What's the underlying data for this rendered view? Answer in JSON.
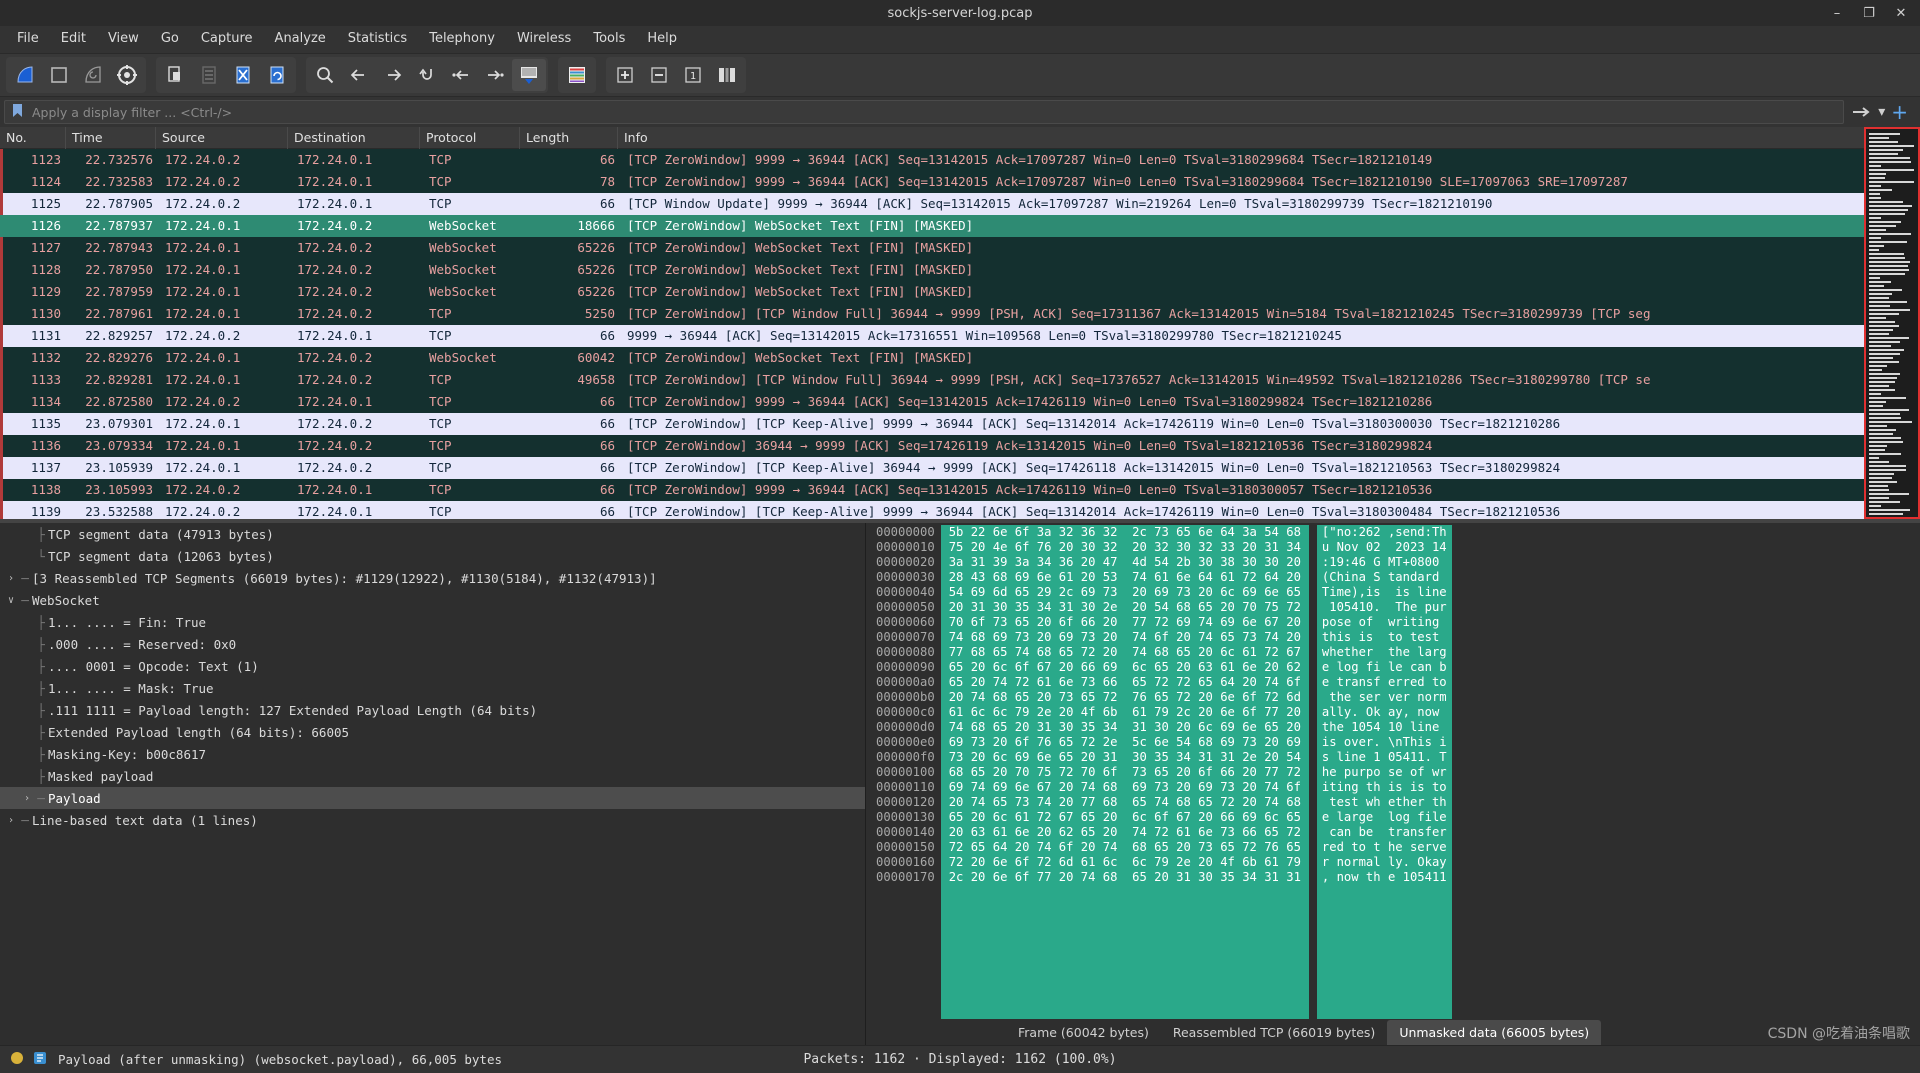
{
  "window": {
    "title": "sockjs-server-log.pcap",
    "controls": {
      "minimize": "–",
      "maximize": "❐",
      "close": "✕"
    }
  },
  "menu": {
    "items": [
      "File",
      "Edit",
      "View",
      "Go",
      "Capture",
      "Analyze",
      "Statistics",
      "Telephony",
      "Wireless",
      "Tools",
      "Help"
    ]
  },
  "toolbar": {
    "groups": [
      [
        "start-capture-icon",
        "stop-capture-icon",
        "restart-capture-icon",
        "capture-options-icon"
      ],
      [
        "open-file-icon",
        "save-file-icon",
        "close-file-icon",
        "reload-file-icon"
      ],
      [
        "find-packet-icon",
        "go-back-icon",
        "go-forward-icon",
        "go-to-packet-icon",
        "go-first-packet-icon",
        "go-last-packet-icon",
        "auto-scroll-icon"
      ],
      [
        "colorize-icon"
      ],
      [
        "zoom-in-icon",
        "zoom-out-icon",
        "zoom-reset-icon",
        "resize-columns-icon"
      ]
    ]
  },
  "filter": {
    "placeholder": "Apply a display filter ... <Ctrl-/>",
    "value": "",
    "bookmark_icon": "bookmark-icon",
    "arrow_icon": "➡",
    "dropdown_icon": "▾",
    "plus_icon": "+"
  },
  "packet_list": {
    "columns": [
      "No.",
      "Time",
      "Source",
      "Destination",
      "Protocol",
      "Length",
      "Info"
    ],
    "rows": [
      {
        "no": "1123",
        "time": "22.732576",
        "src": "172.24.0.2",
        "dst": "172.24.0.1",
        "proto": "TCP",
        "len": "66",
        "info": "[TCP ZeroWindow] 9999 → 36944 [ACK] Seq=13142015 Ack=17097287 Win=0 Len=0 TSval=3180299684 TSecr=1821210149",
        "style": "dark",
        "tick": true
      },
      {
        "no": "1124",
        "time": "22.732583",
        "src": "172.24.0.2",
        "dst": "172.24.0.1",
        "proto": "TCP",
        "len": "78",
        "info": "[TCP ZeroWindow] 9999 → 36944 [ACK] Seq=13142015 Ack=17097287 Win=0 Len=0 TSval=3180299684 TSecr=1821210190 SLE=17097063 SRE=17097287",
        "style": "dark",
        "tick": true
      },
      {
        "no": "1125",
        "time": "22.787905",
        "src": "172.24.0.2",
        "dst": "172.24.0.1",
        "proto": "TCP",
        "len": "66",
        "info": "[TCP Window Update] 9999 → 36944 [ACK] Seq=13142015 Ack=17097287 Win=219264 Len=0 TSval=3180299739 TSecr=1821210190",
        "style": "light",
        "tick": true
      },
      {
        "no": "1126",
        "time": "22.787937",
        "src": "172.24.0.1",
        "dst": "172.24.0.2",
        "proto": "WebSocket",
        "len": "18666",
        "info": "[TCP ZeroWindow] WebSocket Text [FIN] [MASKED]",
        "style": "sel",
        "tick": false
      },
      {
        "no": "1127",
        "time": "22.787943",
        "src": "172.24.0.1",
        "dst": "172.24.0.2",
        "proto": "WebSocket",
        "len": "65226",
        "info": "[TCP ZeroWindow] WebSocket Text [FIN] [MASKED]",
        "style": "dark",
        "tick": true
      },
      {
        "no": "1128",
        "time": "22.787950",
        "src": "172.24.0.1",
        "dst": "172.24.0.2",
        "proto": "WebSocket",
        "len": "65226",
        "info": "[TCP ZeroWindow] WebSocket Text [FIN] [MASKED]",
        "style": "dark",
        "tick": true
      },
      {
        "no": "1129",
        "time": "22.787959",
        "src": "172.24.0.1",
        "dst": "172.24.0.2",
        "proto": "WebSocket",
        "len": "65226",
        "info": "[TCP ZeroWindow] WebSocket Text [FIN] [MASKED]",
        "style": "dark",
        "tick": true
      },
      {
        "no": "1130",
        "time": "22.787961",
        "src": "172.24.0.1",
        "dst": "172.24.0.2",
        "proto": "TCP",
        "len": "5250",
        "info": "[TCP ZeroWindow] [TCP Window Full] 36944 → 9999 [PSH, ACK] Seq=17311367 Ack=13142015 Win=5184 TSval=1821210245 TSecr=3180299739 [TCP seg",
        "style": "dark",
        "tick": true
      },
      {
        "no": "1131",
        "time": "22.829257",
        "src": "172.24.0.2",
        "dst": "172.24.0.1",
        "proto": "TCP",
        "len": "66",
        "info": "9999 → 36944 [ACK] Seq=13142015 Ack=17316551 Win=109568 Len=0 TSval=3180299780 TSecr=1821210245",
        "style": "light",
        "tick": true
      },
      {
        "no": "1132",
        "time": "22.829276",
        "src": "172.24.0.1",
        "dst": "172.24.0.2",
        "proto": "WebSocket",
        "len": "60042",
        "info": "[TCP ZeroWindow] WebSocket Text [FIN] [MASKED]",
        "style": "dark",
        "tick": true
      },
      {
        "no": "1133",
        "time": "22.829281",
        "src": "172.24.0.1",
        "dst": "172.24.0.2",
        "proto": "TCP",
        "len": "49658",
        "info": "[TCP ZeroWindow] [TCP Window Full] 36944 → 9999 [PSH, ACK] Seq=17376527 Ack=13142015 Win=49592 TSval=1821210286 TSecr=3180299780 [TCP se",
        "style": "dark",
        "tick": true
      },
      {
        "no": "1134",
        "time": "22.872580",
        "src": "172.24.0.2",
        "dst": "172.24.0.1",
        "proto": "TCP",
        "len": "66",
        "info": "[TCP ZeroWindow] 9999 → 36944 [ACK] Seq=13142015 Ack=17426119 Win=0 Len=0 TSval=3180299824 TSecr=1821210286",
        "style": "dark",
        "tick": true
      },
      {
        "no": "1135",
        "time": "23.079301",
        "src": "172.24.0.1",
        "dst": "172.24.0.2",
        "proto": "TCP",
        "len": "66",
        "info": "[TCP ZeroWindow] [TCP Keep-Alive] 9999 → 36944 [ACK] Seq=13142014 Ack=17426119 Win=0 Len=0 TSval=3180300030 TSecr=1821210286",
        "style": "light",
        "tick": true
      },
      {
        "no": "1136",
        "time": "23.079334",
        "src": "172.24.0.1",
        "dst": "172.24.0.2",
        "proto": "TCP",
        "len": "66",
        "info": "[TCP ZeroWindow] 36944 → 9999 [ACK] Seq=17426119 Ack=13142015 Win=0 Len=0 TSval=1821210536 TSecr=3180299824",
        "style": "dark",
        "tick": true
      },
      {
        "no": "1137",
        "time": "23.105939",
        "src": "172.24.0.1",
        "dst": "172.24.0.2",
        "proto": "TCP",
        "len": "66",
        "info": "[TCP ZeroWindow] [TCP Keep-Alive] 36944 → 9999 [ACK] Seq=17426118 Ack=13142015 Win=0 Len=0 TSval=1821210563 TSecr=3180299824",
        "style": "light",
        "tick": true
      },
      {
        "no": "1138",
        "time": "23.105993",
        "src": "172.24.0.2",
        "dst": "172.24.0.1",
        "proto": "TCP",
        "len": "66",
        "info": "[TCP ZeroWindow] 9999 → 36944 [ACK] Seq=13142015 Ack=17426119 Win=0 Len=0 TSval=3180300057 TSecr=1821210536",
        "style": "dark",
        "tick": true
      },
      {
        "no": "1139",
        "time": "23.532588",
        "src": "172.24.0.2",
        "dst": "172.24.0.1",
        "proto": "TCP",
        "len": "66",
        "info": "[TCP ZeroWindow] [TCP Keep-Alive] 9999 → 36944 [ACK] Seq=13142014 Ack=17426119 Win=0 Len=0 TSval=3180300484 TSecr=1821210536",
        "style": "light",
        "tick": true
      }
    ]
  },
  "detail_tree": [
    {
      "text": "TCP segment data (47913 bytes)",
      "indent": 2,
      "twist": "",
      "branch": "├",
      "selected": false
    },
    {
      "text": "TCP segment data (12063 bytes)",
      "indent": 2,
      "twist": "",
      "branch": "└",
      "selected": false
    },
    {
      "text": "[3 Reassembled TCP Segments (66019 bytes): #1129(12922), #1130(5184), #1132(47913)]",
      "indent": 1,
      "twist": "›",
      "branch": "",
      "selected": false
    },
    {
      "text": "WebSocket",
      "indent": 1,
      "twist": "∨",
      "branch": "",
      "selected": false
    },
    {
      "text": "1... .... = Fin: True",
      "indent": 2,
      "twist": "",
      "branch": "├",
      "selected": false
    },
    {
      "text": ".000 .... = Reserved: 0x0",
      "indent": 2,
      "twist": "",
      "branch": "├",
      "selected": false
    },
    {
      "text": ".... 0001 = Opcode: Text (1)",
      "indent": 2,
      "twist": "",
      "branch": "├",
      "selected": false
    },
    {
      "text": "1... .... = Mask: True",
      "indent": 2,
      "twist": "",
      "branch": "├",
      "selected": false
    },
    {
      "text": ".111 1111 = Payload length: 127 Extended Payload Length (64 bits)",
      "indent": 2,
      "twist": "",
      "branch": "├",
      "selected": false
    },
    {
      "text": "Extended Payload length (64 bits): 66005",
      "indent": 2,
      "twist": "",
      "branch": "├",
      "selected": false
    },
    {
      "text": "Masking-Key: b00c8617",
      "indent": 2,
      "twist": "",
      "branch": "├",
      "selected": false
    },
    {
      "text": "Masked payload",
      "indent": 2,
      "twist": "",
      "branch": "├",
      "selected": false
    },
    {
      "text": "Payload",
      "indent": 2,
      "twist": "›",
      "branch": "",
      "selected": true
    },
    {
      "text": "Line-based text data (1 lines)",
      "indent": 1,
      "twist": "›",
      "branch": "",
      "selected": false
    }
  ],
  "hex_dump": {
    "rows": [
      {
        "offset": "00000000",
        "hex": "5b 22 6e 6f 3a 32 36 32  2c 73 65 6e 64 3a 54 68",
        "ascii": "[\"no:262 ,send:Th"
      },
      {
        "offset": "00000010",
        "hex": "75 20 4e 6f 76 20 30 32  20 32 30 32 33 20 31 34",
        "ascii": "u Nov 02  2023 14"
      },
      {
        "offset": "00000020",
        "hex": "3a 31 39 3a 34 36 20 47  4d 54 2b 30 38 30 30 20",
        "ascii": ":19:46 G MT+0800"
      },
      {
        "offset": "00000030",
        "hex": "28 43 68 69 6e 61 20 53  74 61 6e 64 61 72 64 20",
        "ascii": "(China S tandard"
      },
      {
        "offset": "00000040",
        "hex": "54 69 6d 65 29 2c 69 73  20 69 73 20 6c 69 6e 65",
        "ascii": "Time),is  is line"
      },
      {
        "offset": "00000050",
        "hex": "20 31 30 35 34 31 30 2e  20 54 68 65 20 70 75 72",
        "ascii": " 105410.  The pur"
      },
      {
        "offset": "00000060",
        "hex": "70 6f 73 65 20 6f 66 20  77 72 69 74 69 6e 67 20",
        "ascii": "pose of  writing"
      },
      {
        "offset": "00000070",
        "hex": "74 68 69 73 20 69 73 20  74 6f 20 74 65 73 74 20",
        "ascii": "this is  to test"
      },
      {
        "offset": "00000080",
        "hex": "77 68 65 74 68 65 72 20  74 68 65 20 6c 61 72 67",
        "ascii": "whether  the larg"
      },
      {
        "offset": "00000090",
        "hex": "65 20 6c 6f 67 20 66 69  6c 65 20 63 61 6e 20 62",
        "ascii": "e log fi le can b"
      },
      {
        "offset": "000000a0",
        "hex": "65 20 74 72 61 6e 73 66  65 72 72 65 64 20 74 6f",
        "ascii": "e transf erred to"
      },
      {
        "offset": "000000b0",
        "hex": "20 74 68 65 20 73 65 72  76 65 72 20 6e 6f 72 6d",
        "ascii": " the ser ver norm"
      },
      {
        "offset": "000000c0",
        "hex": "61 6c 6c 79 2e 20 4f 6b  61 79 2c 20 6e 6f 77 20",
        "ascii": "ally. Ok ay, now"
      },
      {
        "offset": "000000d0",
        "hex": "74 68 65 20 31 30 35 34  31 30 20 6c 69 6e 65 20",
        "ascii": "the 1054 10 line"
      },
      {
        "offset": "000000e0",
        "hex": "69 73 20 6f 76 65 72 2e  5c 6e 54 68 69 73 20 69",
        "ascii": "is over. \\nThis i"
      },
      {
        "offset": "000000f0",
        "hex": "73 20 6c 69 6e 65 20 31  30 35 34 31 31 2e 20 54",
        "ascii": "s line 1 05411. T"
      },
      {
        "offset": "00000100",
        "hex": "68 65 20 70 75 72 70 6f  73 65 20 6f 66 20 77 72",
        "ascii": "he purpo se of wr"
      },
      {
        "offset": "00000110",
        "hex": "69 74 69 6e 67 20 74 68  69 73 20 69 73 20 74 6f",
        "ascii": "iting th is is to"
      },
      {
        "offset": "00000120",
        "hex": "20 74 65 73 74 20 77 68  65 74 68 65 72 20 74 68",
        "ascii": " test wh ether th"
      },
      {
        "offset": "00000130",
        "hex": "65 20 6c 61 72 67 65 20  6c 6f 67 20 66 69 6c 65",
        "ascii": "e large  log file"
      },
      {
        "offset": "00000140",
        "hex": "20 63 61 6e 20 62 65 20  74 72 61 6e 73 66 65 72",
        "ascii": " can be  transfer"
      },
      {
        "offset": "00000150",
        "hex": "72 65 64 20 74 6f 20 74  68 65 20 73 65 72 76 65",
        "ascii": "red to t he serve"
      },
      {
        "offset": "00000160",
        "hex": "72 20 6e 6f 72 6d 61 6c  6c 79 2e 20 4f 6b 61 79",
        "ascii": "r normal ly. Okay"
      },
      {
        "offset": "00000170",
        "hex": "2c 20 6e 6f 77 20 74 68  65 20 31 30 35 34 31 31",
        "ascii": ", now th e 105411"
      }
    ],
    "tabs": [
      {
        "label": "Frame (60042 bytes)",
        "active": false
      },
      {
        "label": "Reassembled TCP (66019 bytes)",
        "active": false
      },
      {
        "label": "Unmasked data (66005 bytes)",
        "active": true
      }
    ]
  },
  "status_bar": {
    "left_icons": [
      "expert-info-icon",
      "capture-file-icon"
    ],
    "field_text": "Payload (after unmasking) (websocket.payload), 66,005 bytes",
    "center_text": "Packets: 1162 · Displayed: 1162 (100.0%)",
    "watermark": "CSDN @吃着油条唱歌"
  },
  "colors": {
    "accent_selected_row": "#2e8b73",
    "row_dark": "#14302f",
    "row_light": "#e7e7fb",
    "hex_highlight": "#2aa98a",
    "minimap_border": "#e03030"
  }
}
